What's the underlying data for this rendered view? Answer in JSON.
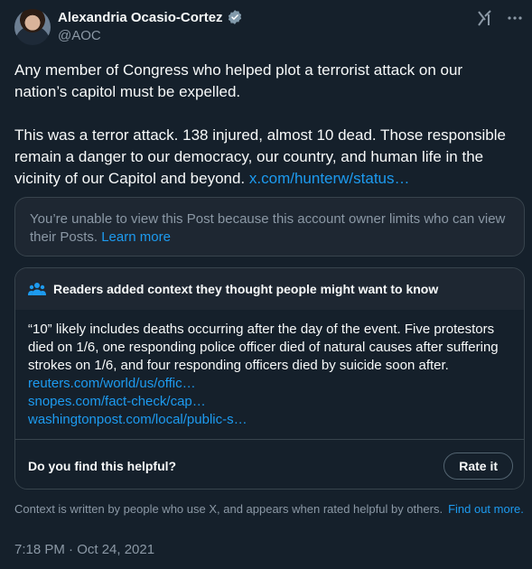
{
  "author": {
    "name": "Alexandria Ocasio-Cortez",
    "handle": "@AOC",
    "verified_icon": "verified-badge-icon"
  },
  "icons": {
    "grok": "x-grok-icon",
    "more": "more-icon",
    "people": "people-icon"
  },
  "tweet": {
    "paragraph1": "Any member of Congress who helped plot a terrorist attack on our nation’s capitol must be expelled.",
    "paragraph2_text": "This was a terror attack. 138 injured, almost 10 dead. Those responsible remain a danger to our democracy, our country, and human life in the vicinity of our Capitol and beyond.",
    "paragraph2_link": "x.com/hunterw/status…"
  },
  "quoted_post": {
    "message": "You’re unable to view this Post because this account owner limits who can view their Posts.",
    "learn_more": "Learn more"
  },
  "community_note": {
    "heading": "Readers added context they thought people might want to know",
    "body": "“10” likely includes deaths occurring after the day of the event. Five protestors died on 1/6, one responding police officer died of natural causes after suffering strokes on 1/6, and four responding officers died by suicide soon after.",
    "links": [
      "reuters.com/world/us/offic…",
      "snopes.com/fact-check/cap…",
      "washingtonpost.com/local/public-s…"
    ],
    "helpful_question": "Do you find this helpful?",
    "rate_button": "Rate it"
  },
  "context_footer": {
    "text": "Context is written by people who use X, and appears when rated helpful by others.",
    "find_out_more": "Find out more."
  },
  "timestamp": "7:18 PM · Oct 24, 2021"
}
